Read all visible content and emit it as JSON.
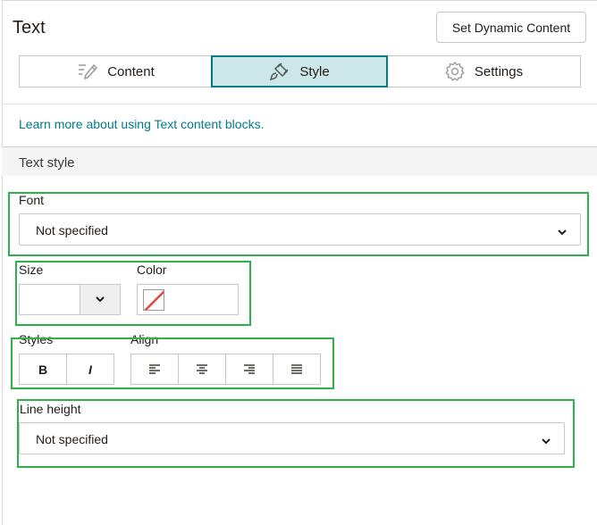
{
  "header": {
    "title": "Text",
    "dynamic_button": "Set Dynamic Content"
  },
  "tabs": [
    {
      "label": "Content",
      "icon": "pencil-list-icon",
      "active": false
    },
    {
      "label": "Style",
      "icon": "paint-brush-icon",
      "active": true
    },
    {
      "label": "Settings",
      "icon": "gear-icon",
      "active": false
    }
  ],
  "learn_link": "Learn more about using Text content blocks.",
  "section": {
    "title": "Text style"
  },
  "font": {
    "label": "Font",
    "value": "Not specified"
  },
  "size": {
    "label": "Size",
    "value": ""
  },
  "color": {
    "label": "Color",
    "value": "none"
  },
  "styles": {
    "label": "Styles",
    "bold": "B",
    "italic": "I"
  },
  "align": {
    "label": "Align",
    "options": [
      "left",
      "center",
      "right",
      "justify"
    ]
  },
  "line_height": {
    "label": "Line height",
    "value": "Not specified"
  },
  "colors": {
    "accent": "#007c89",
    "active_tab_bg": "#cce7e9",
    "highlight": "#2db14a",
    "swatch_none": "#e0463e"
  }
}
